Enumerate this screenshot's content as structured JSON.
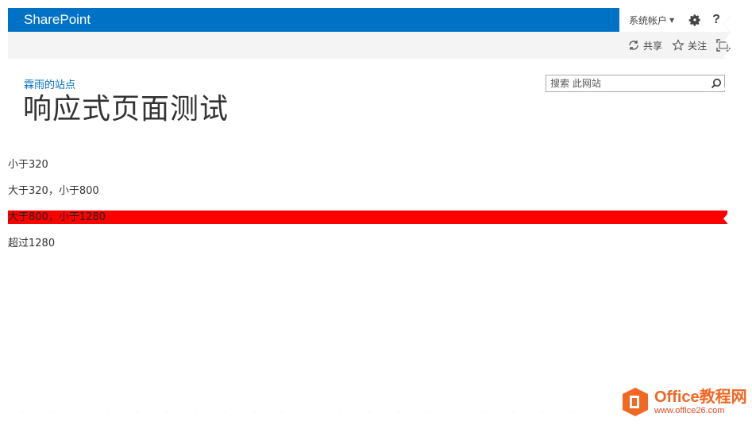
{
  "suitebar": {
    "brand": "SharePoint",
    "account": "系统帐户",
    "help": "?"
  },
  "ribbon": {
    "share": "共享",
    "follow": "关注"
  },
  "header": {
    "breadcrumb": "霖雨的站点",
    "title": "响应式页面测试",
    "search_placeholder": "搜索 此网站"
  },
  "content": {
    "items": [
      "小于320",
      "大于320，小于800",
      "大于800，小于1280",
      "超过1280"
    ],
    "highlight_color": "#ff0000"
  },
  "watermark": {
    "main": "Office教程网",
    "url": "www.office26.com"
  },
  "colors": {
    "suite_blue": "#0072c6",
    "link_blue": "#0072c6",
    "logo_orange": "#f26722"
  }
}
